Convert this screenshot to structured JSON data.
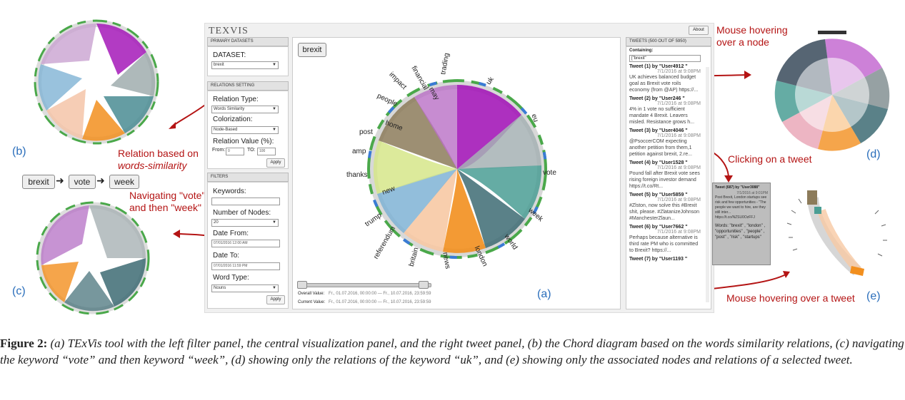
{
  "app": {
    "title": "TEXVIS",
    "about_label": "About",
    "search_chip": "brexit",
    "panel_label": "(a)",
    "left": {
      "primary_title": "PRIMARY DATASETS",
      "dataset_label": "DATASET:",
      "dataset_value": "brexit",
      "relations_title": "RELATIONS SETTING",
      "relation_type_label": "Relation Type:",
      "relation_type_value": "Words Similarity",
      "colorization_label": "Colorization:",
      "colorization_value": "Node-Based",
      "relation_value_label": "Relation Value (%):",
      "from_label": "From:",
      "from_value": "0",
      "to_label": "TO:",
      "to_value": "100",
      "apply1": "Apply",
      "filters_title": "FILTERS",
      "keywords_label": "Keywords:",
      "nodes_label": "Number of Nodes:",
      "nodes_value": "20",
      "date_from_label": "Date From:",
      "date_from_value": "07/01/2016 12:00 AM",
      "date_to_label": "Date To:",
      "date_to_value": "07/01/2016 11:59 PM",
      "word_type_label": "Word Type:",
      "word_type_value": "Nouns",
      "apply2": "Apply"
    },
    "center": {
      "overall_label": "Overall Value:",
      "overall_value": "Fr., 01.07.2016, 00:00:00 — Fr., 10.07.2016, 23:59:59",
      "current_label": "Current Value:",
      "current_value": "Fr., 01.07.2016, 00:00:00 — Fr., 10.07.2016, 23:59:59",
      "nodes": [
        "uk",
        "eu",
        "vote",
        "week",
        "world",
        "london",
        "news",
        "britain",
        "referendum",
        "trump",
        "new",
        "thanks",
        "amp",
        "post",
        "home",
        "people",
        "impact",
        "financial",
        "may",
        "trading"
      ]
    },
    "right": {
      "header": "TWEETS (500 OUT OF 5950)",
      "containing_label": "Containing:",
      "containing_value": "[\"brexit\"",
      "tweets": [
        {
          "title": "Tweet (1) by \"User4912 \"",
          "time": "7/1/2016 at 9:08PM",
          "text": "UK achieves balanced budget goal as Brexit vote roils economy (from @AP) https://..."
        },
        {
          "title": "Tweet (2) by \"User246 \"",
          "time": "7/1/2016 at 9:08PM",
          "text": "4% in 1 vote no sufficient mandate 4 Brexit. Leavers misled. Resistance grows h..."
        },
        {
          "title": "Tweet (3) by \"User4046 \"",
          "time": "7/1/2016 at 9:08PM",
          "text": "@PsoccerCOM expecting another petition from them,1 petition against brexit, 2.re..."
        },
        {
          "title": "Tweet (4) by \"User1528 \"",
          "time": "7/1/2016 at 9:08PM",
          "text": "Pound fall after Brexit vote sees rising foreign investor demand https://t.co/Rt..."
        },
        {
          "title": "Tweet (5) by \"User5859 \"",
          "time": "7/1/2016 at 9:08PM",
          "text": "#Zlston, now solve this #Brexit shit, please. #ZlatanizeJohnson #ManchesterZlaun..."
        },
        {
          "title": "Tweet (6) by \"User7662 \"",
          "time": "7/1/2016 at 9:08PM",
          "text": "Perhaps because alternative is third rate PM who is committed to Brexit? https://..."
        },
        {
          "title": "Tweet (7) by \"User1193 \"",
          "time": "",
          "text": ""
        }
      ]
    }
  },
  "annotations": {
    "b": "(b)",
    "b_caption_1": "Relation based on",
    "b_caption_2": "words-similarity",
    "c": "(c)",
    "c_caption_1": "Navigating \"vote\"",
    "c_caption_2": "and then \"week\"",
    "breadcrumb": [
      "brexit",
      "vote",
      "week"
    ],
    "d": "(d)",
    "d_caption_1": "Mouse hovering",
    "d_caption_2": "over a node",
    "clicking": "Clicking on a tweet",
    "e": "(e)",
    "e_caption": "Mouse hovering over a tweet",
    "popup_title": "Tweet (687) by \"User3088\"",
    "popup_time": "7/1/2016 at 9:01PM",
    "popup_text": "Post Brexit, London startups see risk and few opportunities - \"The people we want to hire, are they still inter... https://t.co/NZSU0OzFFJ",
    "popup_words": "Words: \"brexit\" , \"london\" , \"opportunities\" , \"people\" , \"post\" , \"risk\" , \"startups\""
  },
  "caption": {
    "label": "Figure 2:",
    "text": "(a) TExVis tool with the left filter panel, the central visualization panel, and the right tweet panel, (b) the Chord diagram based on the words similarity relations, (c) navigating the keyword “vote” and then keyword “week”, (d) showing only the relations of the keyword “uk”, and (e) showing only the associated nodes and relations of a selected tweet."
  },
  "colors": {
    "purple": "#a419b8",
    "teal": "#4a9e94",
    "orange": "#f28f1e",
    "slate": "#3d6b73",
    "accent_red": "#b41414",
    "label_blue": "#2a6ebb"
  }
}
